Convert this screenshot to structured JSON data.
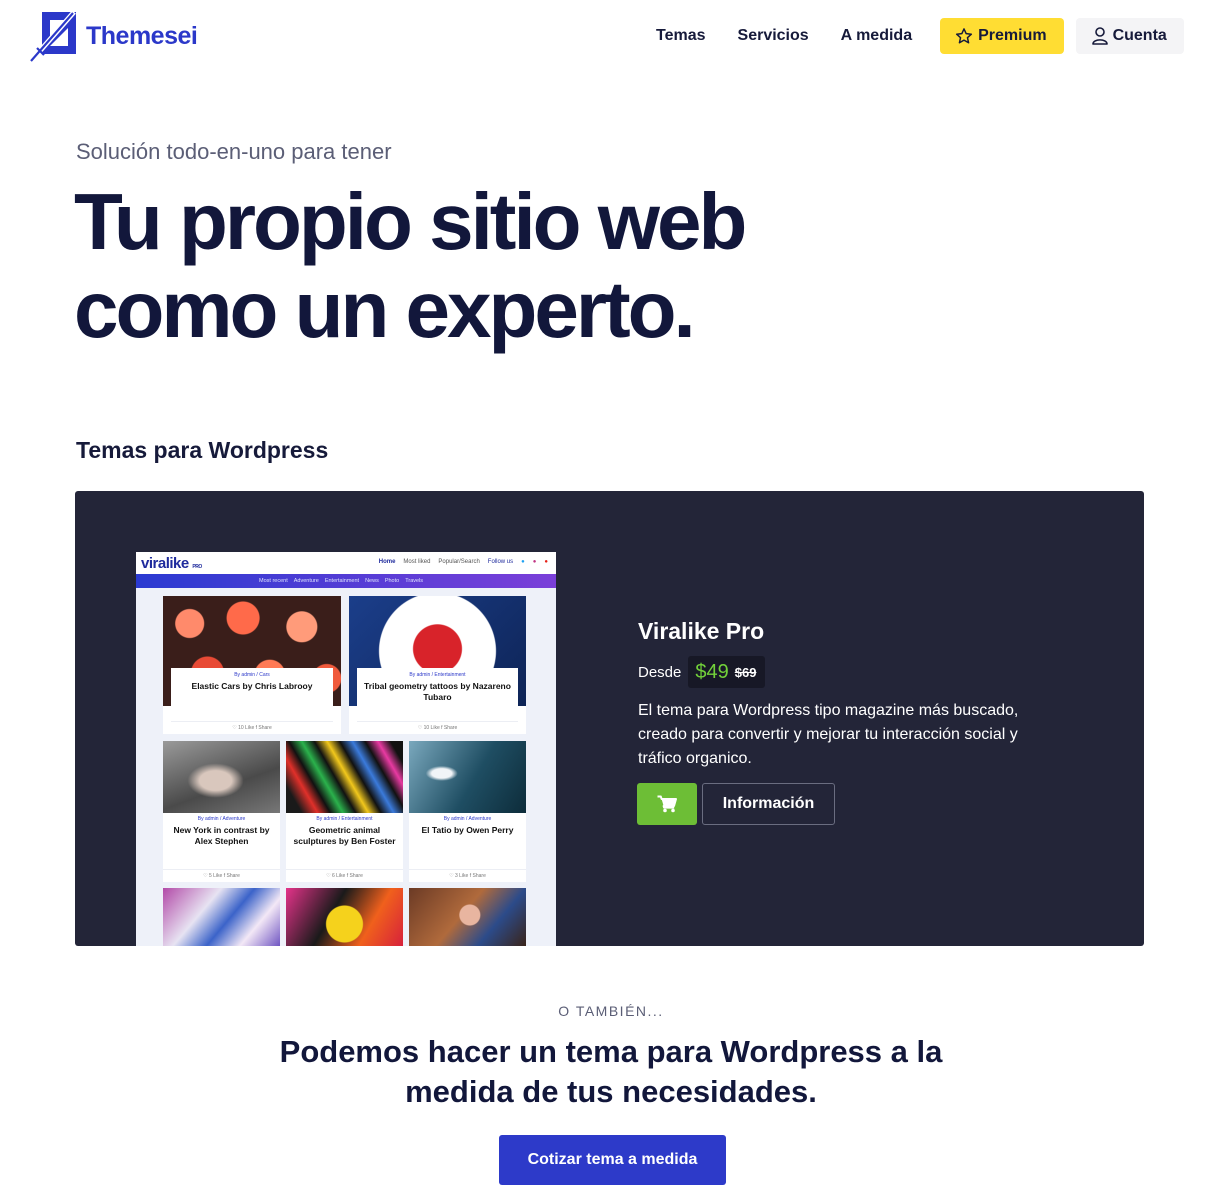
{
  "header": {
    "logo_text": "Themesei",
    "nav": [
      "Temas",
      "Servicios",
      "A medida"
    ],
    "premium_label": "Premium",
    "account_label": "Cuenta"
  },
  "hero": {
    "subtitle": "Solución todo-en-uno para tener",
    "title_line1": "Tu propio sitio web",
    "title_line2": "como un experto."
  },
  "section_title": "Temas para Wordpress",
  "product": {
    "name": "Viralike Pro",
    "desde": "Desde",
    "price": "$49",
    "old_price": "$69",
    "description": "El tema para Wordpress tipo magazine más buscado, creado para convertir y mejorar tu interacción social y tráfico organico.",
    "info_label": "Información",
    "cart_icon": "shopping-cart-icon"
  },
  "screenshot": {
    "logo": "viralike",
    "logo_suffix": "PRO",
    "menu": [
      "Home",
      "Most liked",
      "Popular/Search",
      "Follow us"
    ],
    "categories": [
      "Most recent",
      "Adventure",
      "Entertainment",
      "News",
      "Photo",
      "Travels"
    ],
    "posts": [
      {
        "meta": "By admin / Cars",
        "title": "Elastic Cars by Chris Labrooy",
        "foot": "♡ 10 Like   f Share"
      },
      {
        "meta": "By admin / Entertainment",
        "title": "Tribal geometry tattoos by Nazareno Tubaro",
        "foot": "♡ 10 Like   f Share"
      },
      {
        "meta": "By admin / Adventure",
        "title": "New York in contrast by Alex Stephen",
        "foot": "♡ 5 Like   f Share"
      },
      {
        "meta": "By admin / Entertainment",
        "title": "Geometric animal sculptures by Ben Foster",
        "foot": "♡ 6 Like   f Share"
      },
      {
        "meta": "By admin / Adventure",
        "title": "El Tatio by Owen Perry",
        "foot": "♡ 3 Like   f Share"
      }
    ]
  },
  "bottom": {
    "eyebrow": "O TAMBIÉN...",
    "title": "Podemos hacer un tema para Wordpress a la medida de tus necesidades.",
    "button": "Cotizar tema a medida"
  },
  "colors": {
    "brand": "#2b38c9",
    "premium": "#ffdd33",
    "card_bg": "#232538",
    "price_green": "#72d13a",
    "cart_green": "#6dbe36"
  }
}
